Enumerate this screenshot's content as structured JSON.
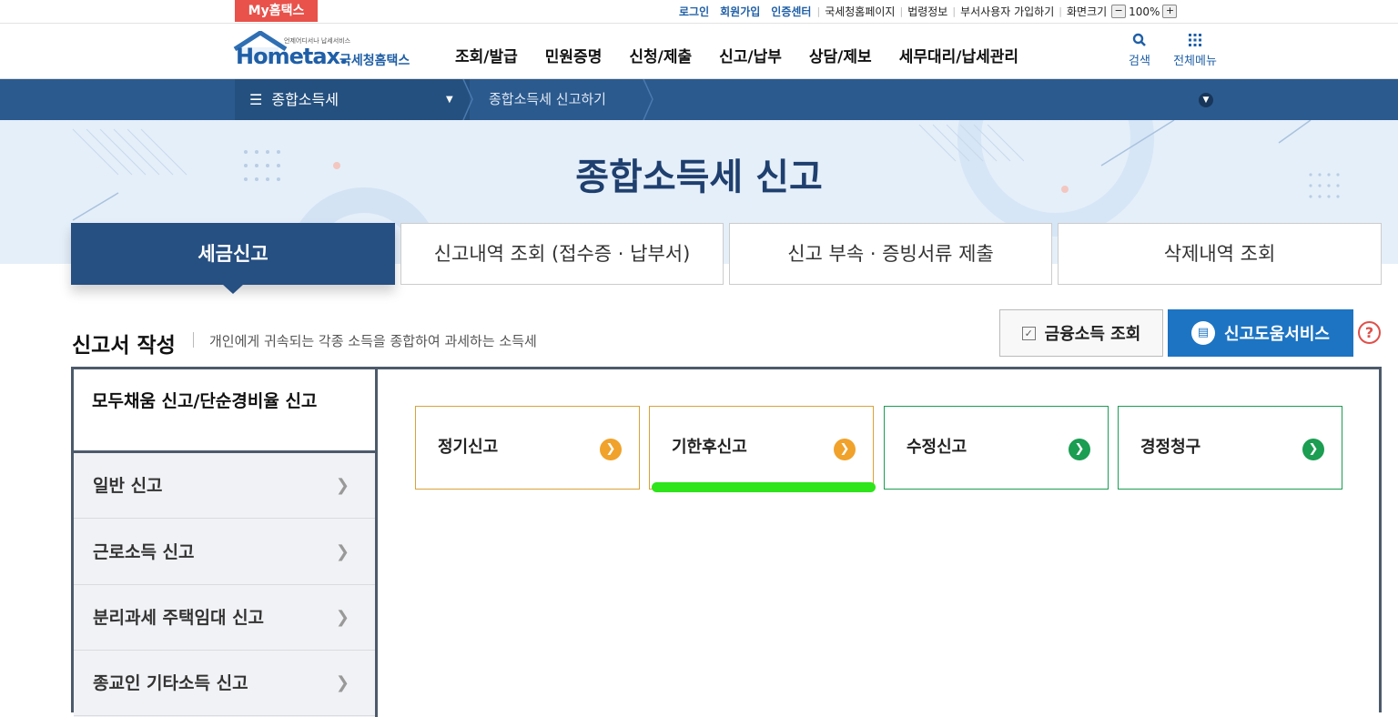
{
  "topbar": {
    "my_hometax": "My홈택스",
    "links": [
      {
        "label": "로그인",
        "emph": true
      },
      {
        "label": "회원가입",
        "emph": true
      },
      {
        "label": "인증센터",
        "emph": true
      },
      {
        "label": "국세청홈페이지",
        "emph": false
      },
      {
        "label": "법령정보",
        "emph": false
      },
      {
        "label": "부서사용자 가입하기",
        "emph": false
      },
      {
        "label": "화면크기",
        "emph": false
      }
    ],
    "zoom_minus": "−",
    "zoom_value": "100%",
    "zoom_plus": "+"
  },
  "header": {
    "logo_small": "언제어디서나 납세서비스",
    "logo_main": "Hometax.",
    "logo_kr": "국세청홈택스",
    "nav": [
      "조회/발급",
      "민원증명",
      "신청/제출",
      "신고/납부",
      "상담/제보",
      "세무대리/납세관리"
    ],
    "search_label": "검색",
    "allmenu_label": "전체메뉴"
  },
  "location": {
    "menu": "종합소득세",
    "current": "종합소득세 신고하기"
  },
  "hero": {
    "title": "종합소득세 신고"
  },
  "tabs": [
    {
      "label": "세금신고",
      "active": true
    },
    {
      "label": "신고내역 조회 (접수증 · 납부서)",
      "active": false
    },
    {
      "label": "신고 부속 · 증빙서류 제출",
      "active": false
    },
    {
      "label": "삭제내역 조회",
      "active": false
    }
  ],
  "section": {
    "title": "신고서 작성",
    "desc": "개인에게 귀속되는 각종 소득을 종합하여 과세하는 소득세",
    "finance_button": "금융소득 조회",
    "help_button": "신고도움서비스",
    "help_icon": "?"
  },
  "sidebar": {
    "active": "모두채움 신고/단순경비율 신고",
    "items": [
      "일반 신고",
      "근로소득 신고",
      "분리과세 주택임대 신고",
      "종교인 기타소득 신고"
    ]
  },
  "cards": [
    {
      "label": "정기신고",
      "color": "#f0a22b"
    },
    {
      "label": "기한후신고",
      "color": "#f0a22b"
    },
    {
      "label": "수정신고",
      "color": "#1b9d52"
    },
    {
      "label": "경정청구",
      "color": "#1b9d52"
    }
  ],
  "colors": {
    "brand_navy": "#264f82",
    "brand_blue": "#1d74c3",
    "highlight": "#2ee41a"
  }
}
